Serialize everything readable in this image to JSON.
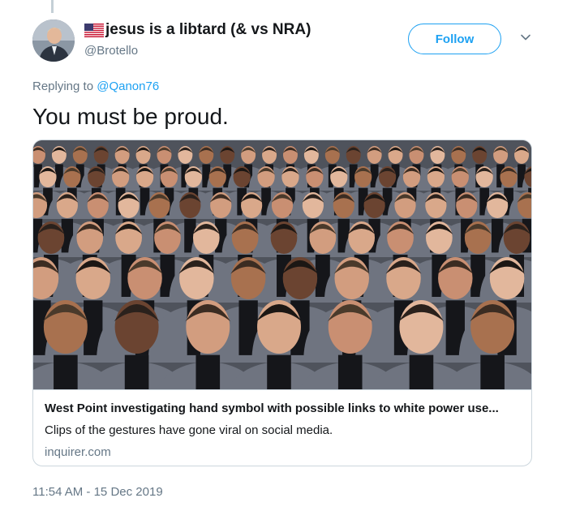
{
  "tweet": {
    "display_name": "jesus is a libtard (& vs NRA)",
    "flag_icon": "us-flag-icon",
    "handle": "@Brotello",
    "follow_label": "Follow",
    "replying_prefix": "Replying to",
    "replying_to": "@Qanon76",
    "text": "You must be proud.",
    "timestamp": "11:54 AM - 15 Dec 2019"
  },
  "card": {
    "title": "West Point investigating hand symbol with possible links to white power use...",
    "description": "Clips of the gestures have gone viral on social media.",
    "domain": "inquirer.com"
  },
  "colors": {
    "accent": "#1da1f2",
    "secondary_text": "#657786",
    "border": "#ccd6dd"
  }
}
